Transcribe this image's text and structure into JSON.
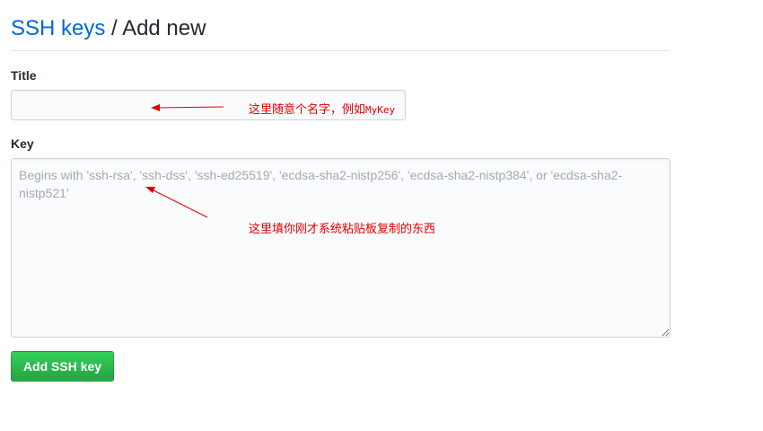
{
  "breadcrumb": {
    "parent": "SSH keys",
    "separator": "/",
    "current": "Add new"
  },
  "form": {
    "title_label": "Title",
    "title_value": "",
    "key_label": "Key",
    "key_value": "",
    "key_placeholder": "Begins with 'ssh-rsa', 'ssh-dss', 'ssh-ed25519', 'ecdsa-sha2-nistp256', 'ecdsa-sha2-nistp384', or 'ecdsa-sha2-nistp521'",
    "submit_label": "Add SSH key"
  },
  "annotations": {
    "title_note_prefix": "这里随意个名字，例如",
    "title_note_example": "MyKey",
    "key_note": "这里填你刚才系统粘贴板复制的东西"
  },
  "colors": {
    "link": "#0366d6",
    "annotation": "#e00000",
    "button": "#28a745"
  },
  "icons": {
    "arrow_title": "arrow-left-icon",
    "arrow_key": "arrow-up-left-icon"
  }
}
